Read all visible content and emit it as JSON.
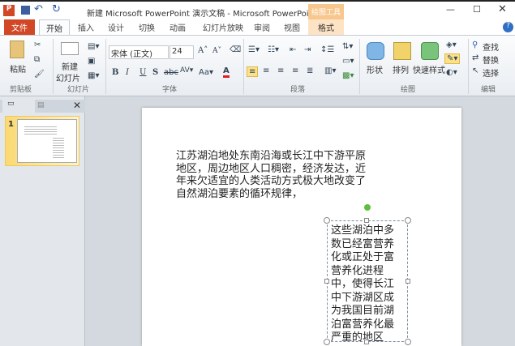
{
  "title": "新建 Microsoft PowerPoint 演示文稿 - Microsoft PowerPoint",
  "contextual_tab": "绘图工具",
  "tabs": [
    "文件",
    "开始",
    "插入",
    "设计",
    "切换",
    "动画",
    "幻灯片放映",
    "审阅",
    "视图",
    "格式"
  ],
  "ribbon": {
    "paste": "粘贴",
    "new_slide": "新建",
    "slide_label": "幻灯片",
    "font_name": "宋体 (正文)",
    "font_size": "24",
    "shape": "形状",
    "arrange": "排列",
    "quick_style": "快速样式",
    "find": "查找",
    "replace": "替换",
    "select": "选择",
    "groups": [
      "剪贴板",
      "幻灯片",
      "字体",
      "段落",
      "绘图",
      "编辑"
    ]
  },
  "slide_number": "1",
  "slide": {
    "text1": "江苏湖泊地处东南沿海或长江中下游平原地区，周边地区人口稠密，经济发达，近年来欠适宜的人类活动方式极大地改变了自然湖泊要素的循环规律，",
    "text2": "这些湖泊中多数已经富营养化或正处于富营养化进程中，使得长江中下游湖区成为我国目前湖泊富营养化最严重的地区"
  }
}
